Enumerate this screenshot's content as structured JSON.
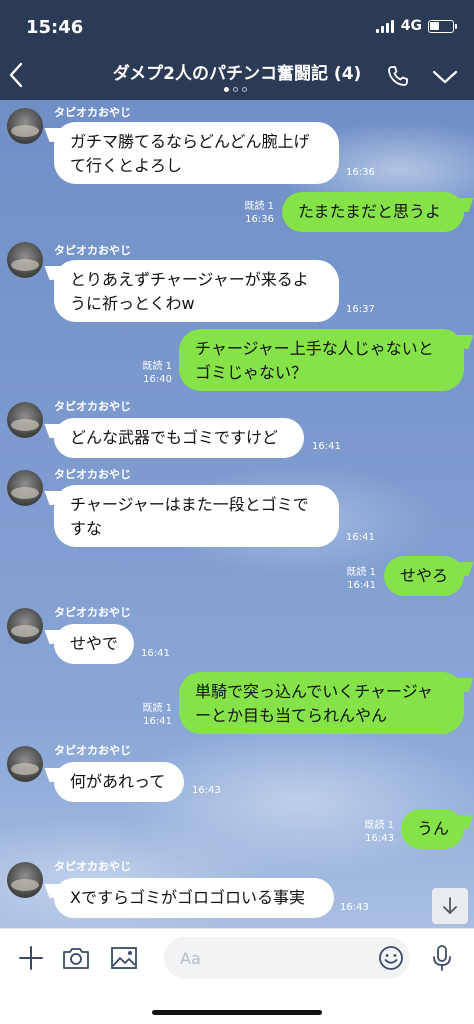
{
  "status_bar": {
    "time": "15:46",
    "network": "4G"
  },
  "header": {
    "title": "ダメプ2人のパチンコ奮闘記 (4)"
  },
  "messages": [
    {
      "dir": "in",
      "sender": "タピオカおやじ",
      "lines": [
        "ガチマ勝てるならどんどん腕上げ",
        "て行くとよろし"
      ],
      "time": "16:36"
    },
    {
      "dir": "out",
      "read": "既読 1",
      "lines": [
        "たまたまだと思うよ"
      ],
      "time": "16:36"
    },
    {
      "dir": "in",
      "sender": "タピオカおやじ",
      "lines": [
        "とりあえずチャージャーが来るよ",
        "うに祈っとくわw"
      ],
      "time": "16:37"
    },
    {
      "dir": "out",
      "read": "既読 1",
      "lines": [
        "チャージャー上手な人じゃないと",
        "ゴミじゃない？"
      ],
      "time": "16:40"
    },
    {
      "dir": "in",
      "sender": "タピオカおやじ",
      "lines": [
        "どんな武器でもゴミですけど"
      ],
      "time": "16:41"
    },
    {
      "dir": "in",
      "sender": "タピオカおやじ",
      "lines": [
        "チャージャーはまた一段とゴミで",
        "すな"
      ],
      "time": "16:41"
    },
    {
      "dir": "out",
      "read": "既読 1",
      "lines": [
        "せやろ"
      ],
      "time": "16:41"
    },
    {
      "dir": "in",
      "sender": "タピオカおやじ",
      "lines": [
        "せやで"
      ],
      "time": "16:41"
    },
    {
      "dir": "out",
      "read": "既読 1",
      "lines": [
        "単騎で突っ込んでいくチャージャ",
        "ーとか目も当てられんやん"
      ],
      "time": "16:41"
    },
    {
      "dir": "in",
      "sender": "タピオカおやじ",
      "lines": [
        "何があれって"
      ],
      "time": "16:43"
    },
    {
      "dir": "out",
      "read": "既読 1",
      "lines": [
        "うん"
      ],
      "time": "16:43"
    },
    {
      "dir": "in",
      "sender": "タピオカおやじ",
      "lines": [
        "Xですらゴミがゴロゴロいる事実"
      ],
      "time": "16:43"
    }
  ],
  "input": {
    "placeholder": "Aa"
  },
  "icons": {
    "back": "chevron-left-icon",
    "phone": "phone-icon",
    "collapse": "chevron-down-icon",
    "plus": "plus-icon",
    "camera": "camera-icon",
    "image": "image-icon",
    "emoji": "emoji-icon",
    "mic": "microphone-icon",
    "scroll": "arrow-down-icon"
  },
  "colors": {
    "header_bg": "#2b3a55",
    "outgoing_bubble": "#85e249",
    "incoming_bubble": "#ffffff",
    "chat_bg": "#7d9bcf",
    "input_bg": "#f2f3f5"
  }
}
